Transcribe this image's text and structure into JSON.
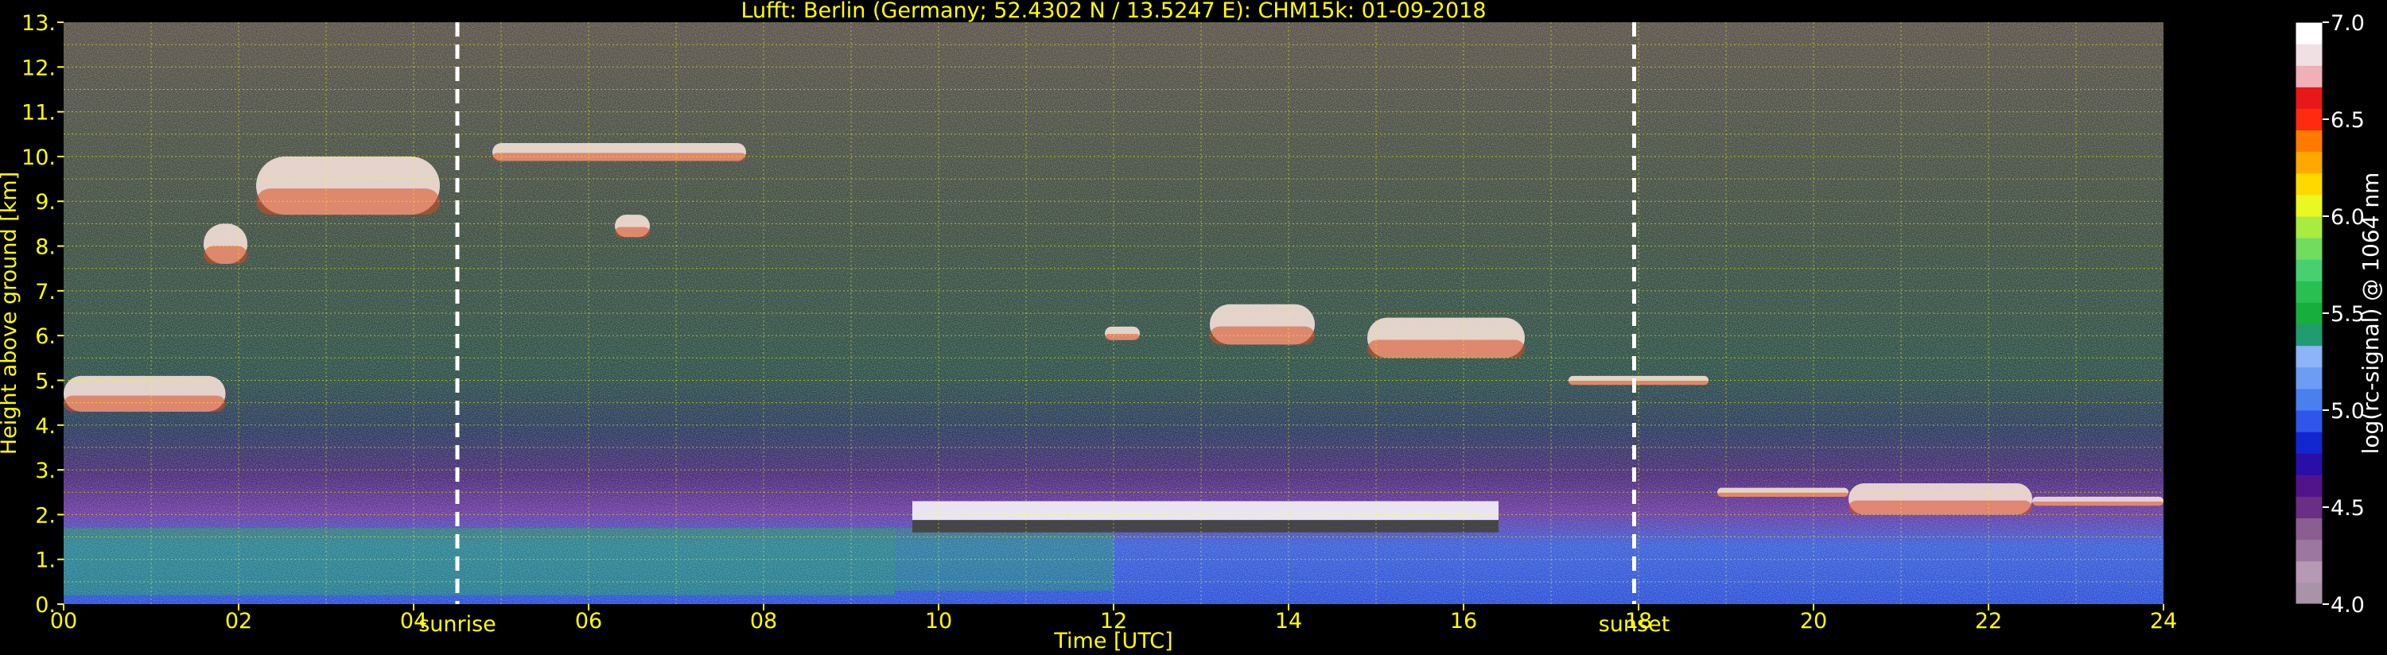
{
  "chart_data": {
    "type": "heatmap",
    "title": "Lufft: Berlin (Germany; 52.4302 N / 13.5247 E):    CHM15k: 01-09-2018",
    "xlabel": "Time [UTC]",
    "ylabel": "Height above ground [km]",
    "x_ticks": [
      "00",
      "02",
      "04",
      "06",
      "08",
      "10",
      "12",
      "14",
      "16",
      "18",
      "20",
      "22",
      "24"
    ],
    "y_ticks": [
      "0.",
      "1.",
      "2.",
      "3.",
      "4.",
      "5.",
      "6.",
      "7.",
      "8.",
      "9.",
      "10.",
      "11.",
      "12.",
      "13."
    ],
    "xlim": [
      0,
      24
    ],
    "ylim": [
      0,
      13
    ],
    "grid": true,
    "annotations": [
      {
        "label": "sunrise",
        "x": 4.5
      },
      {
        "label": "sunset",
        "x": 17.95
      }
    ],
    "colorbar": {
      "label": "log(rc-signal) @ 1064 nm",
      "ticks": [
        "4.0",
        "4.5",
        "5.0",
        "5.5",
        "6.0",
        "6.5",
        "7.0"
      ],
      "range": [
        4.0,
        7.0
      ],
      "colors": [
        "#a893a8",
        "#b699b4",
        "#9c78a0",
        "#8a5e90",
        "#6a2e82",
        "#52148a",
        "#2a0ea8",
        "#1426d0",
        "#2e56e8",
        "#4a7ff0",
        "#6c9cf4",
        "#8cb4f6",
        "#209c70",
        "#18ae3c",
        "#28c050",
        "#48d070",
        "#70dc60",
        "#a8ec40",
        "#e8f820",
        "#ffd800",
        "#ffa800",
        "#ff7a00",
        "#ff2a10",
        "#e81818",
        "#f0b0b8",
        "#f0e0e4",
        "#ffffff"
      ]
    },
    "regions": [
      {
        "feature": "cloud",
        "t0": 0.0,
        "t1": 1.85,
        "h0": 4.3,
        "h1": 5.1
      },
      {
        "feature": "cloud",
        "t0": 1.6,
        "t1": 2.1,
        "h0": 7.6,
        "h1": 8.5
      },
      {
        "feature": "cloud",
        "t0": 2.2,
        "t1": 4.3,
        "h0": 8.7,
        "h1": 10.0
      },
      {
        "feature": "cloud",
        "t0": 4.9,
        "t1": 7.8,
        "h0": 9.9,
        "h1": 10.3
      },
      {
        "feature": "cloud",
        "t0": 6.3,
        "t1": 6.7,
        "h0": 8.2,
        "h1": 8.7
      },
      {
        "feature": "cloud",
        "t0": 11.9,
        "t1": 12.3,
        "h0": 5.9,
        "h1": 6.2
      },
      {
        "feature": "cloud",
        "t0": 13.1,
        "t1": 14.3,
        "h0": 5.8,
        "h1": 6.7
      },
      {
        "feature": "cloud",
        "t0": 14.9,
        "t1": 16.7,
        "h0": 5.5,
        "h1": 6.4
      },
      {
        "feature": "cloud",
        "t0": 17.2,
        "t1": 18.8,
        "h0": 4.9,
        "h1": 5.1
      },
      {
        "feature": "cloud",
        "t0": 18.9,
        "t1": 20.4,
        "h0": 2.4,
        "h1": 2.6
      },
      {
        "feature": "cloud",
        "t0": 20.4,
        "t1": 22.5,
        "h0": 2.0,
        "h1": 2.7
      },
      {
        "feature": "cloud",
        "t0": 22.5,
        "t1": 24.0,
        "h0": 2.2,
        "h1": 2.4
      },
      {
        "feature": "boundary-layer-top",
        "t0": 9.7,
        "t1": 16.4,
        "h0": 1.6,
        "h1": 2.3
      }
    ]
  }
}
